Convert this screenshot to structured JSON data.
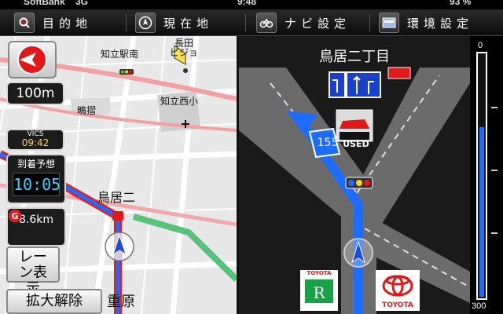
{
  "status_bar": {
    "carrier": "SoftBank",
    "network": "3G",
    "time": "9:48",
    "battery": "93 %"
  },
  "menu": {
    "destination_label": "目的地",
    "current_location_label": "現在地",
    "navi_settings_label": "ナビ設定",
    "environment_settings_label": "環境設定"
  },
  "left_map": {
    "scale_label": "100m",
    "vics_label": "VICS",
    "vics_time": "09:42",
    "arrival_label": "到着予想",
    "arrival_time": "10:05",
    "distance": "8.6km",
    "lane_button": "レーン表示",
    "zoom_release_button": "拡大解除",
    "places": {
      "station": "知立駅南",
      "nagata": "長田",
      "pigeon": "ピジョ",
      "school": "知立西小",
      "shigi": "鴫摺",
      "toriiji": "鳥居二",
      "shigehara": "重原"
    }
  },
  "right_panel": {
    "title": "鳥居二丁目",
    "route_number": "155",
    "used_label": "USED",
    "toyota_rental_label": "TOYOTA",
    "toyota_label": "TOYOTA"
  },
  "scale_indicator": {
    "top_value": "0",
    "bottom_value": "300",
    "level_fraction": 0.3
  },
  "colors": {
    "route": "#1e6bff",
    "accent_red": "#e01818",
    "panel_bg": "#1c1c1c"
  }
}
